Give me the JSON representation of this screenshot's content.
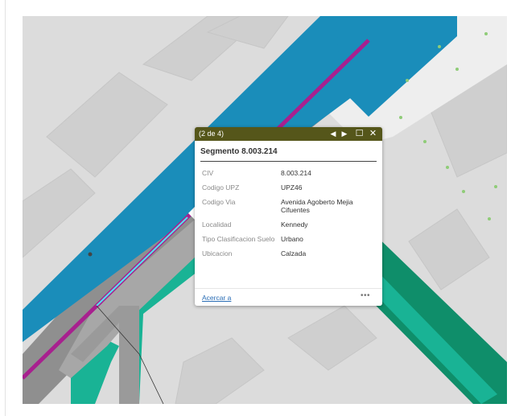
{
  "map": {
    "colors": {
      "background": "#dcdcdc",
      "blocks": "#cfcfcf",
      "roadway": "#8f8f8f",
      "median": "#a7a7a7",
      "blue_band": "#1a8dba",
      "teal_border": "#19b395",
      "dark_green": "#0f8e6a",
      "magenta_line": "#a8208f",
      "cyan_highlight": "#52e5ef",
      "sidewalk": "#eeeeee",
      "dot_green": "#8fcc78"
    }
  },
  "popup": {
    "counter": "(2 de 4)",
    "buttons": {
      "previous_icon": "◀",
      "next_icon": "▶",
      "maximize_icon": "☐",
      "close_icon": "✕"
    },
    "title": "Segmento 8.003.214",
    "attributes": [
      {
        "key": "CIV",
        "value": "8.003.214"
      },
      {
        "key": "Codigo UPZ",
        "value": "UPZ46"
      },
      {
        "key": "Codigo Via",
        "value": "Avenida Agoberto Mejia Cifuentes"
      },
      {
        "key": "Localidad",
        "value": "Kennedy"
      },
      {
        "key": "Tipo Clasificacion Suelo",
        "value": "Urbano"
      },
      {
        "key": "Ubicacion",
        "value": "Calzada"
      }
    ],
    "footer": {
      "zoom_label": "Acercar a",
      "more_label": "•••"
    }
  }
}
